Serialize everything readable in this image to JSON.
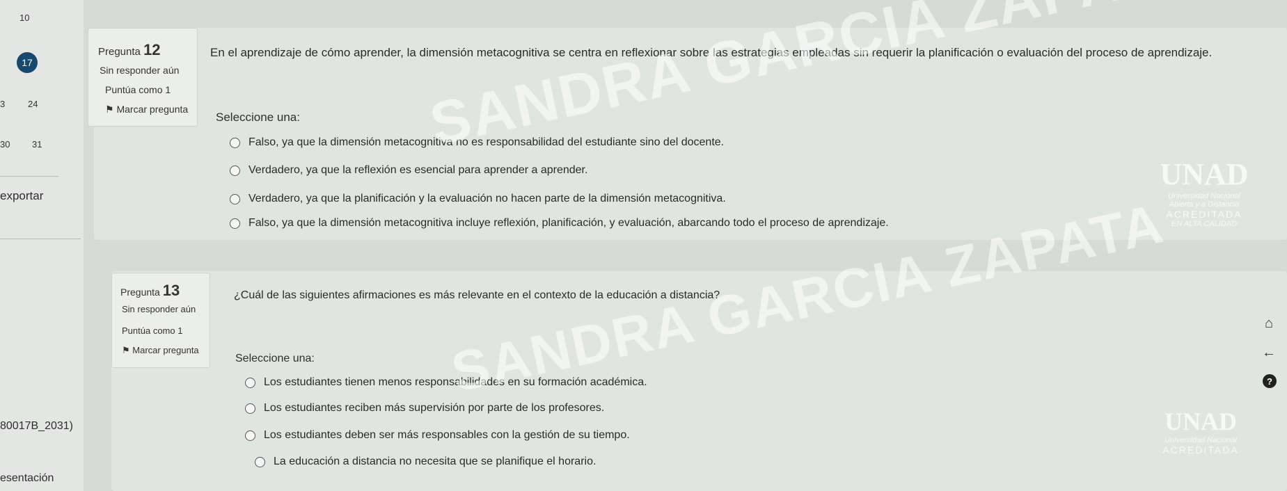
{
  "nav": {
    "top_number": "10",
    "current": "17",
    "n24": "24",
    "n3": "3",
    "n31": "31",
    "n30": "30",
    "exportar": "exportar",
    "course_code": "80017B_2031)",
    "presentacion": "esentación"
  },
  "q12": {
    "label": "Pregunta",
    "number": "12",
    "status": "Sin responder aún",
    "score": "Puntúa como 1",
    "flag": "Marcar pregunta",
    "text": "En el aprendizaje de cómo aprender, la dimensión metacognitiva se centra en reflexionar sobre las estrategias empleadas sin requerir la planificación o evaluación del proceso de aprendizaje.",
    "prompt": "Seleccione una:",
    "options": [
      "Falso, ya que la dimensión metacognitiva no es responsabilidad del estudiante sino del docente.",
      "Verdadero, ya que la reflexión es esencial para aprender a aprender.",
      "Verdadero, ya que la planificación y la evaluación no hacen parte de la dimensión metacognitiva.",
      "Falso, ya que la dimensión metacognitiva incluye reflexión, planificación, y evaluación, abarcando todo el proceso de aprendizaje."
    ]
  },
  "q13": {
    "label": "Pregunta",
    "number": "13",
    "status": "Sin responder aún",
    "score": "Puntúa como 1",
    "flag": "Marcar pregunta",
    "text": "¿Cuál de las siguientes afirmaciones es más relevante en el contexto de la educación a distancia?",
    "prompt": "Seleccione una:",
    "options": [
      "Los estudiantes tienen menos responsabilidades en su formación académica.",
      "Los estudiantes reciben más supervisión por parte de los profesores.",
      "Los estudiantes deben ser más responsables con la gestión de su tiempo.",
      "La educación a distancia no necesita que se planifique el horario."
    ]
  },
  "watermark": {
    "text": "SANDRA GARCIA ZAPATA"
  },
  "logo": {
    "name": "UNAD",
    "subtitle1": "Universidad Nacional",
    "subtitle2": "Abierta y a Distancia",
    "accredited": "ACREDITADA",
    "quality": "EN ALTA CALIDAD"
  },
  "icons": {
    "home": "home-icon",
    "back": "arrow-left-icon",
    "help": "question-icon",
    "flag": "flag-icon"
  }
}
